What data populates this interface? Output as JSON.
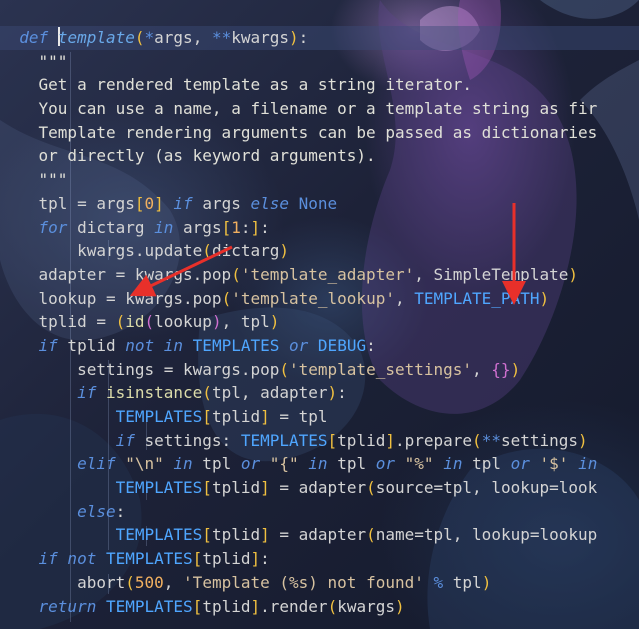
{
  "code_lines": [
    "def template(*args, **kwargs):",
    "    \"\"\"",
    "    Get a rendered template as a string iterator.",
    "    You can use a name, a filename or a template string as fir",
    "    Template rendering arguments can be passed as dictionaries",
    "    or directly (as keyword arguments).",
    "    \"\"\"",
    "    tpl = args[0] if args else None",
    "    for dictarg in args[1:]:",
    "        kwargs.update(dictarg)",
    "    adapter = kwargs.pop('template_adapter', SimpleTemplate)",
    "    lookup = kwargs.pop('template_lookup', TEMPLATE_PATH)",
    "    tplid = (id(lookup), tpl)",
    "    if tplid not in TEMPLATES or DEBUG:",
    "        settings = kwargs.pop('template_settings', {})",
    "        if isinstance(tpl, adapter):",
    "            TEMPLATES[tplid] = tpl",
    "            if settings: TEMPLATES[tplid].prepare(**settings)",
    "        elif \"\\n\" in tpl or \"{\" in tpl or \"%\" in tpl or '$' in",
    "            TEMPLATES[tplid] = adapter(source=tpl, lookup=look",
    "        else:",
    "            TEMPLATES[tplid] = adapter(name=tpl, lookup=lookup",
    "    if not TEMPLATES[tplid]:",
    "        abort(500, 'Template (%s) not found' % tpl)",
    "    return TEMPLATES[tplid].render(kwargs)"
  ],
  "annotations": {
    "arrow_color": "#e8302a",
    "arrow_1_points_to": "lookup",
    "arrow_2_points_to": "TEMPLATE_PATH"
  },
  "theme": {
    "keyword": "#5b8fdd",
    "function_name": "#69a8e8",
    "string": "#d7c2a0",
    "number": "#f2b060",
    "constant": "#4fa6ff",
    "text": "#d4d4d4"
  }
}
